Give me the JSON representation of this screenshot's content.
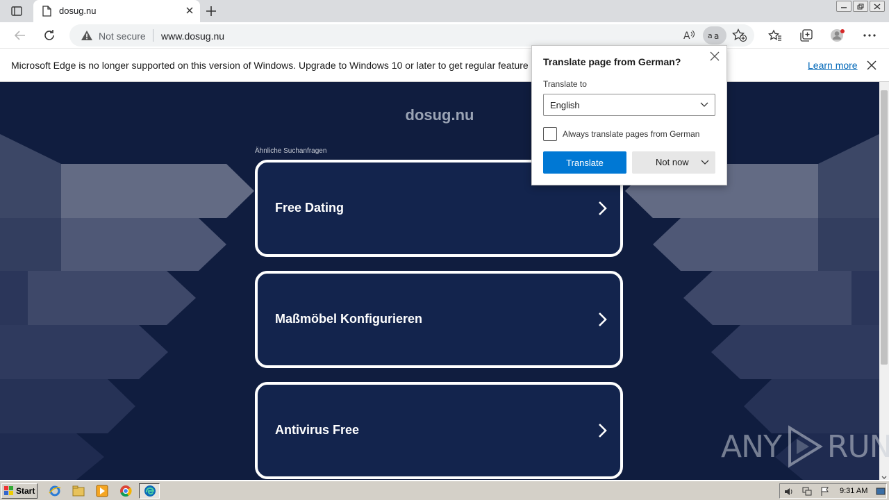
{
  "browser": {
    "tab_title": "dosug.nu",
    "address": {
      "security_label": "Not secure",
      "url": "www.dosug.nu"
    }
  },
  "infobar": {
    "message": "Microsoft Edge is no longer supported on this version of Windows. Upgrade to Windows 10 or later to get regular feature and",
    "link_label": "Learn more"
  },
  "page": {
    "site_title": "dosug.nu",
    "related_label": "Ähnliche Suchanfragen",
    "cards": [
      {
        "label": "Free Dating"
      },
      {
        "label": "Maßmöbel Konfigurieren"
      },
      {
        "label": "Antivirus Free"
      }
    ]
  },
  "translate_popup": {
    "title": "Translate page from  German?",
    "translate_to_label": "Translate to",
    "selected_language": "English",
    "always_translate_label": "Always translate pages from German",
    "always_translate_checked": false,
    "translate_button": "Translate",
    "not_now_button": "Not now"
  },
  "taskbar": {
    "start_label": "Start",
    "clock": "9:31 AM"
  },
  "watermark": {
    "left": "ANY",
    "right": "RUN"
  },
  "colors": {
    "page_background": "#101d3f",
    "card_fill": "#13244d",
    "accent_blue": "#0078d4",
    "link_blue": "#0067b8"
  }
}
